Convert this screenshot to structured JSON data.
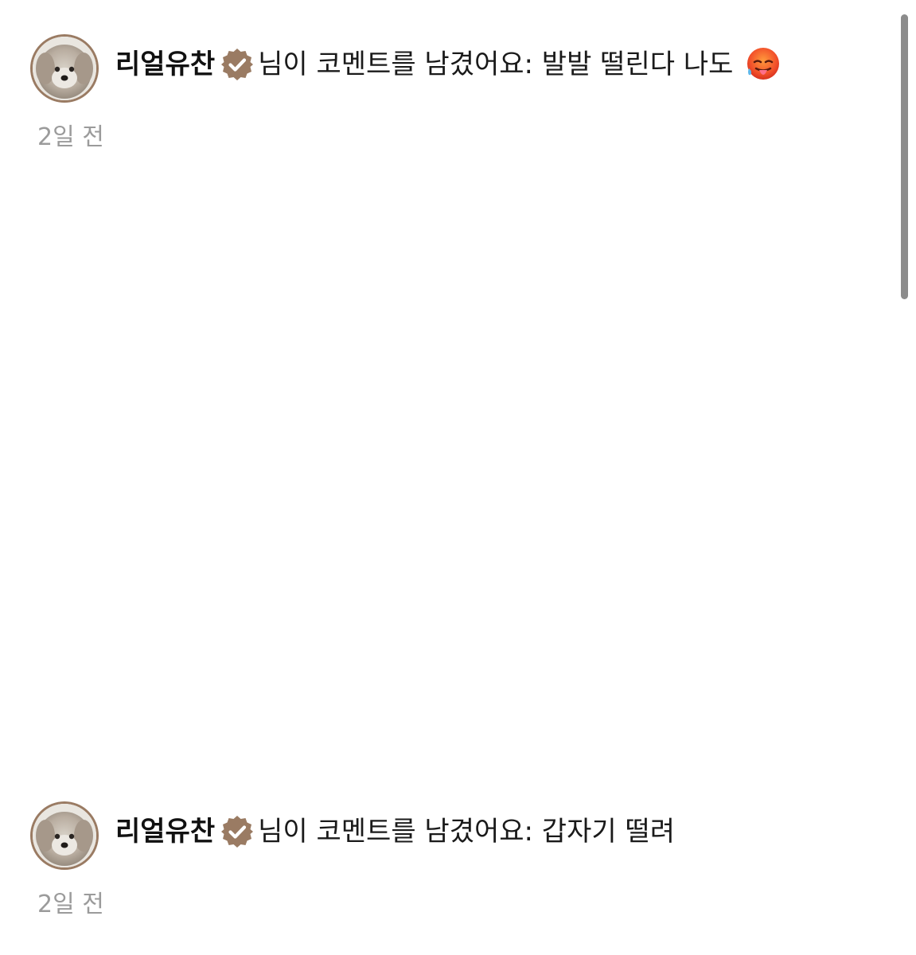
{
  "notifications": [
    {
      "username": "리얼유찬",
      "verified_icon": "verified-badge-icon",
      "message": "님이 코멘트를 남겼어요: 발발 떨린다 나도",
      "emoji": "hot-face-emoji",
      "time": "2일 전"
    },
    {
      "username": "리얼유찬",
      "verified_icon": "verified-badge-icon",
      "message": "님이 코멘트를 남겼어요: 갑자기 떨려",
      "time": "2일 전"
    }
  ],
  "colors": {
    "verified_badge": "#9a7b63",
    "avatar_border": "#9a7b63",
    "timestamp": "#9b9b9b",
    "scrollbar": "#8c8c8c"
  }
}
